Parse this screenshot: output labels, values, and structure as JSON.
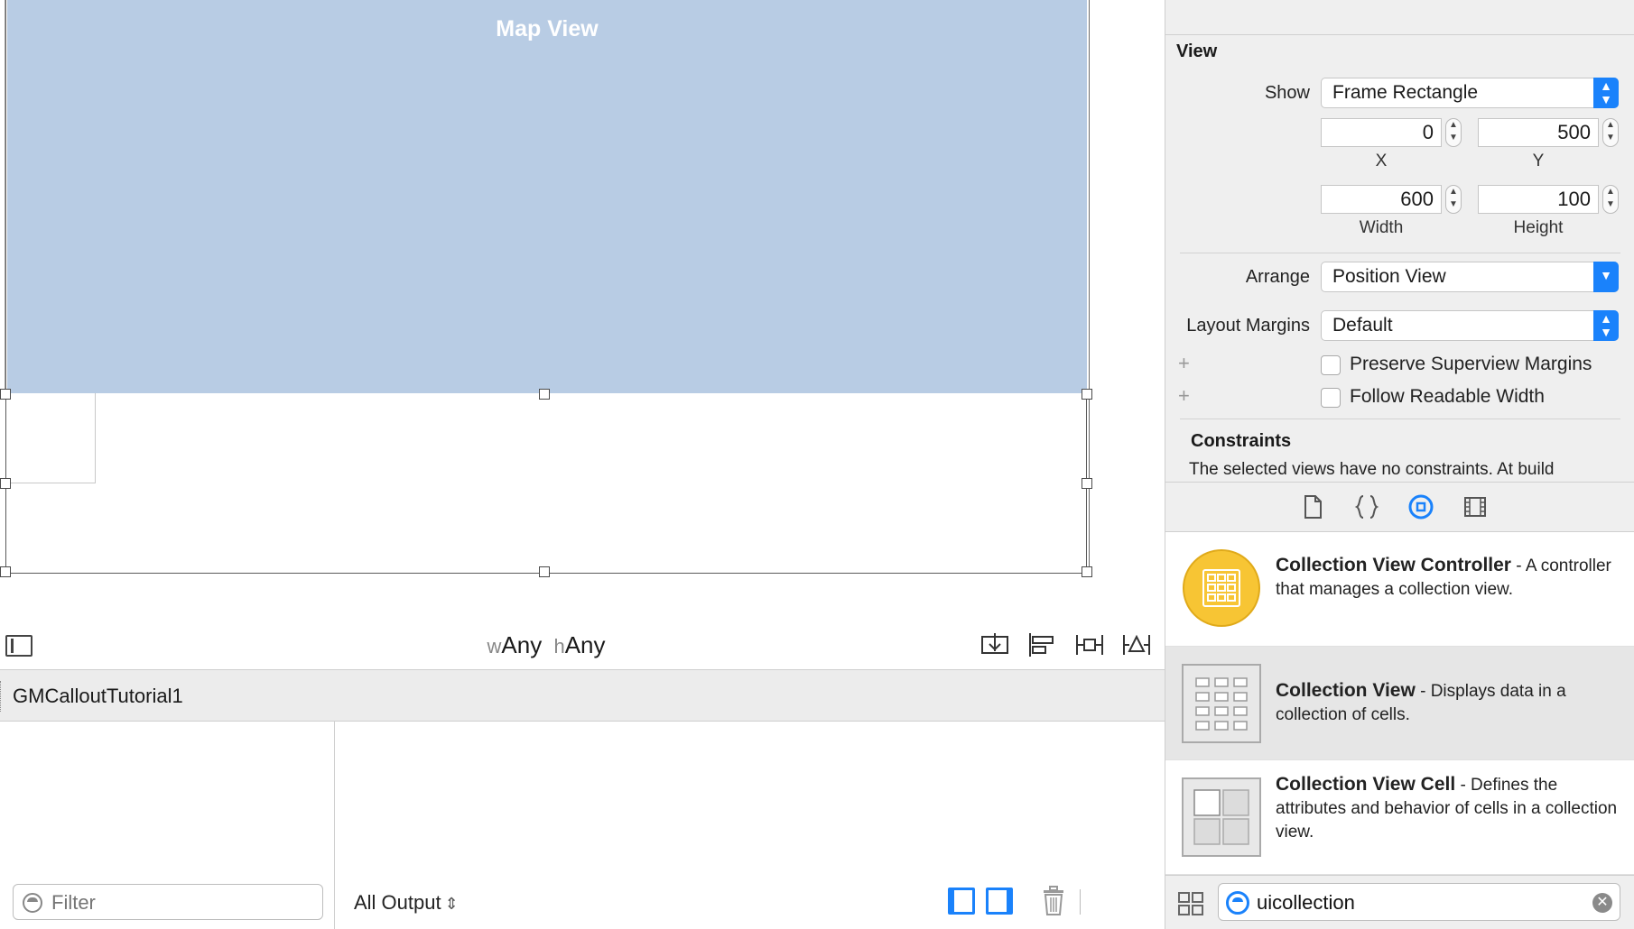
{
  "canvas": {
    "map_view_label": "Map View",
    "size_class": {
      "w_prefix": "w",
      "w_value": "Any",
      "h_prefix": "h",
      "h_value": "Any"
    },
    "toolbar_icons": [
      "embed-in-stack-icon",
      "align-icon",
      "pin-icon",
      "resolve-issues-icon"
    ]
  },
  "debug_bar": {
    "project_name": "GMCalloutTutorial1"
  },
  "debug_area": {
    "filter_placeholder": "Filter",
    "output_selector": "All Output"
  },
  "inspector": {
    "section_title": "View",
    "show_label": "Show",
    "show_value": "Frame Rectangle",
    "x_value": "0",
    "x_caption": "X",
    "y_value": "500",
    "y_caption": "Y",
    "width_value": "600",
    "width_caption": "Width",
    "height_value": "100",
    "height_caption": "Height",
    "arrange_label": "Arrange",
    "arrange_value": "Position View",
    "layout_margins_label": "Layout Margins",
    "layout_margins_value": "Default",
    "preserve_superview_margins": "Preserve Superview Margins",
    "follow_readable_width": "Follow Readable Width",
    "constraints_title": "Constraints",
    "constraints_text": "The selected views have no constraints. At build"
  },
  "library": {
    "items": [
      {
        "title": "Collection View Controller",
        "desc": " - A controller that manages a collection view.",
        "icon": "collection-view-controller-icon",
        "selected": false
      },
      {
        "title": "Collection View",
        "desc": " - Displays data in a collection of cells.",
        "icon": "collection-view-icon",
        "selected": true
      },
      {
        "title": "Collection View Cell",
        "desc": " - Defines the attributes and behavior of cells in a collection view.",
        "icon": "collection-view-cell-icon",
        "selected": false
      }
    ],
    "search_value": "uicollection"
  },
  "colors": {
    "accent": "#1a82fb",
    "map_view_bg": "#b8cce4",
    "controller_icon": "#f7c534"
  }
}
